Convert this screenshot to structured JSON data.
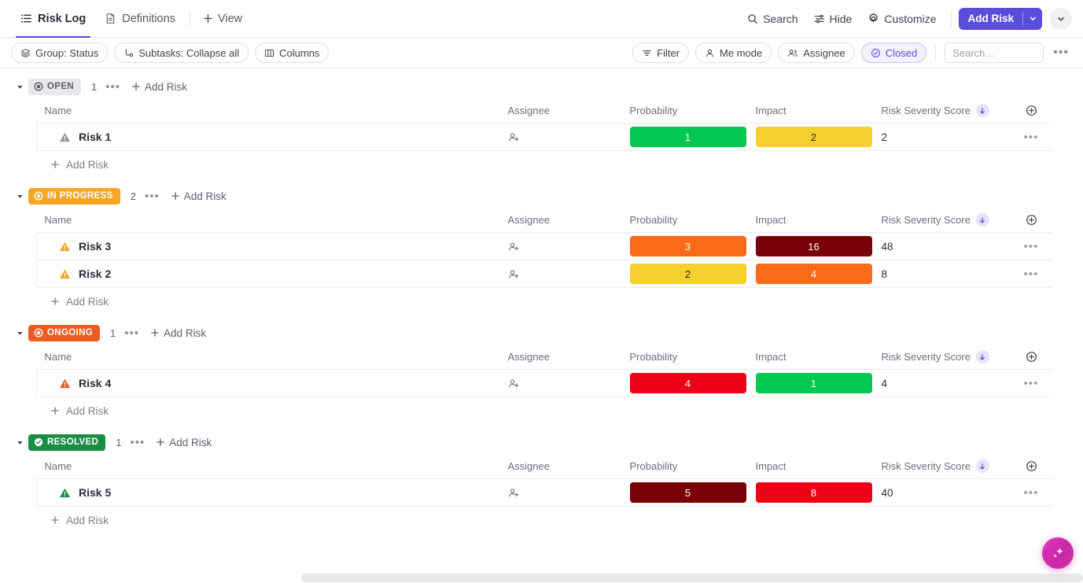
{
  "nav": {
    "tabs": [
      {
        "label": "Risk Log",
        "icon": "list-icon",
        "active": true
      },
      {
        "label": "Definitions",
        "icon": "document-icon",
        "active": false
      }
    ],
    "add_view_label": "View",
    "add_view_icon": "plus-icon"
  },
  "top_actions": {
    "search_label": "Search",
    "search_icon": "search-icon",
    "hide_label": "Hide",
    "hide_icon": "sliders-icon",
    "customize_label": "Customize",
    "customize_icon": "gear-icon",
    "add_risk_label": "Add Risk",
    "add_risk_caret_icon": "chevron-down-icon",
    "overflow_caret_icon": "chevron-down-icon",
    "accent_color": "#5b4ddb"
  },
  "filter_bar": {
    "left_chips": [
      {
        "label": "Group: Status",
        "icon": "layers-icon"
      },
      {
        "label": "Subtasks: Collapse all",
        "icon": "subtask-icon"
      },
      {
        "label": "Columns",
        "icon": "columns-icon"
      }
    ],
    "right_chips": [
      {
        "label": "Filter",
        "icon": "filter-icon",
        "accent": false
      },
      {
        "label": "Me mode",
        "icon": "person-icon",
        "accent": false
      },
      {
        "label": "Assignee",
        "icon": "people-icon",
        "accent": false
      },
      {
        "label": "Closed",
        "icon": "check-circle-icon",
        "accent": true
      }
    ],
    "search_placeholder": "Search...",
    "search_value": "",
    "overflow_icon": "ellipsis-icon",
    "accent_color": "#5b4ddb"
  },
  "table": {
    "columns": [
      "Name",
      "Assignee",
      "Probability",
      "Impact",
      "Risk Severity Score"
    ],
    "sorted_column": "Risk Severity Score",
    "sort_direction_icon": "arrow-down-icon",
    "add_column_icon": "plus-circle-icon",
    "assignee_icon": "add-person-icon",
    "row_menu_icon": "ellipsis-icon",
    "add_row_label": "Add Risk",
    "add_row_icon": "plus-icon"
  },
  "groups": [
    {
      "status": "OPEN",
      "badge_bg": "#e8e8ec",
      "badge_fg": "#5c6068",
      "badge_icon": "status-circle-icon",
      "count": "1",
      "add_label": "Add Risk",
      "rows": [
        {
          "name": "Risk 1",
          "icon": "warning-triangle-icon",
          "icon_color": "#8d97a5",
          "probability": {
            "value": "1",
            "bg": "#00c853",
            "fg": "#ffffff"
          },
          "impact": {
            "value": "2",
            "bg": "#f5cf2d",
            "fg": "#2e2e2e"
          },
          "score": "2"
        }
      ]
    },
    {
      "status": "IN PROGRESS",
      "badge_bg": "#f5a623",
      "badge_fg": "#ffffff",
      "badge_icon": "status-circle-icon",
      "count": "2",
      "add_label": "Add Risk",
      "rows": [
        {
          "name": "Risk 3",
          "icon": "warning-triangle-icon",
          "icon_color": "#f5a623",
          "probability": {
            "value": "3",
            "bg": "#fa6b19",
            "fg": "#ffffff"
          },
          "impact": {
            "value": "16",
            "bg": "#7a0008",
            "fg": "#ffffff"
          },
          "score": "48"
        },
        {
          "name": "Risk 2",
          "icon": "warning-triangle-icon",
          "icon_color": "#f5a623",
          "probability": {
            "value": "2",
            "bg": "#f5cf2d",
            "fg": "#2e2e2e"
          },
          "impact": {
            "value": "4",
            "bg": "#fa6b19",
            "fg": "#ffffff"
          },
          "score": "8"
        }
      ]
    },
    {
      "status": "ONGOING",
      "badge_bg": "#ec5c22",
      "badge_fg": "#ffffff",
      "badge_icon": "status-circle-icon",
      "count": "1",
      "add_label": "Add Risk",
      "rows": [
        {
          "name": "Risk 4",
          "icon": "warning-triangle-icon",
          "icon_color": "#ec5c22",
          "probability": {
            "value": "4",
            "bg": "#ed0015",
            "fg": "#ffffff"
          },
          "impact": {
            "value": "1",
            "bg": "#00c853",
            "fg": "#ffffff"
          },
          "score": "4"
        }
      ]
    },
    {
      "status": "RESOLVED",
      "badge_bg": "#1a8c46",
      "badge_fg": "#ffffff",
      "badge_icon": "check-circle-filled-icon",
      "count": "1",
      "add_label": "Add Risk",
      "rows": [
        {
          "name": "Risk 5",
          "icon": "warning-triangle-icon",
          "icon_color": "#1a8c46",
          "probability": {
            "value": "5",
            "bg": "#7a0008",
            "fg": "#ffffff"
          },
          "impact": {
            "value": "8",
            "bg": "#ed0015",
            "fg": "#ffffff"
          },
          "score": "40"
        }
      ]
    }
  ],
  "ai_button": {
    "icon": "sparkle-icon",
    "color": "#d62ab0"
  }
}
